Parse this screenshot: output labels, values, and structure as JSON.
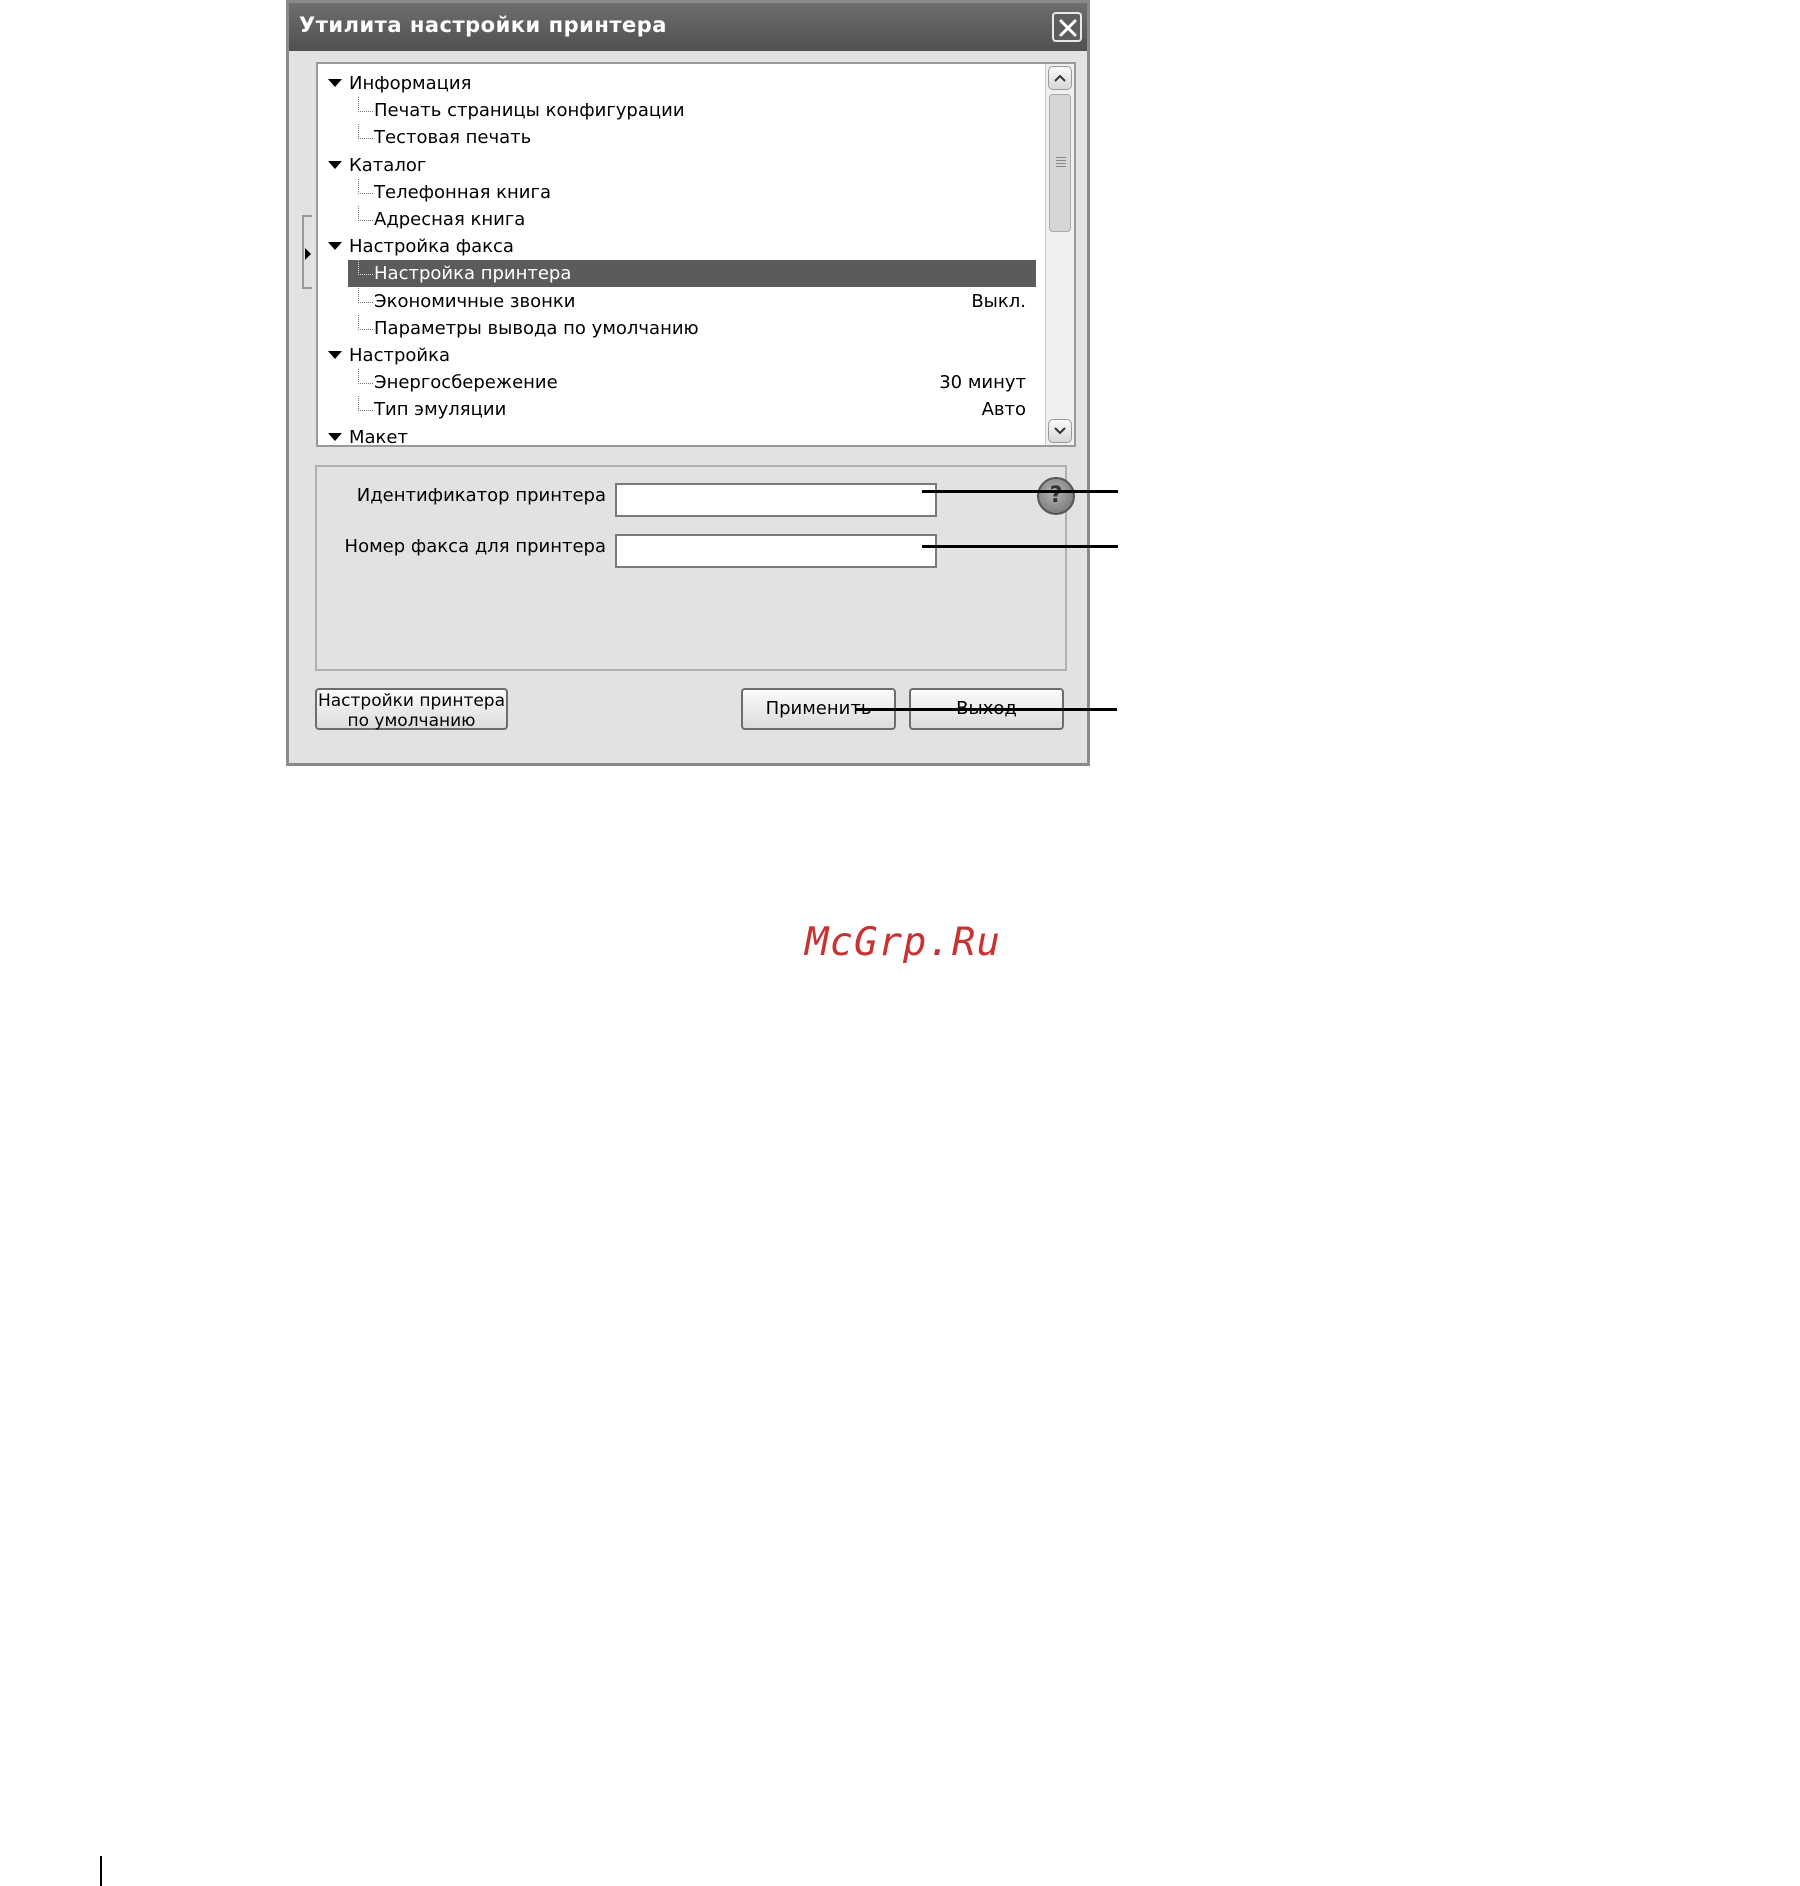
{
  "window": {
    "title": "Утилита настройки принтера"
  },
  "tree": {
    "rows": [
      {
        "type": "category",
        "label": "Информация"
      },
      {
        "type": "item",
        "label": "Печать страницы конфигурации",
        "value": ""
      },
      {
        "type": "item",
        "label": "Тестовая печать",
        "value": ""
      },
      {
        "type": "category",
        "label": "Каталог"
      },
      {
        "type": "item",
        "label": "Телефонная книга",
        "value": ""
      },
      {
        "type": "item",
        "label": "Адресная книга",
        "value": ""
      },
      {
        "type": "category",
        "label": "Настройка факса"
      },
      {
        "type": "item",
        "label": "Настройка принтера",
        "value": "",
        "selected": true
      },
      {
        "type": "item",
        "label": "Экономичные звонки",
        "value": "Выкл."
      },
      {
        "type": "item",
        "label": "Параметры вывода по умолчанию",
        "value": ""
      },
      {
        "type": "category",
        "label": "Настройка"
      },
      {
        "type": "item",
        "label": "Энергосбережение",
        "value": "30 минут"
      },
      {
        "type": "item",
        "label": "Тип эмуляции",
        "value": "Авто"
      },
      {
        "type": "category",
        "label": "Макет"
      }
    ]
  },
  "form": {
    "printer_id_label": "Идентификатор принтера",
    "printer_id_value": "",
    "fax_number_label": "Номер факса для принтера",
    "fax_number_value": "",
    "help_glyph": "?"
  },
  "buttons": {
    "defaults_line1": "Настройки принтера",
    "defaults_line2": "по умолчанию",
    "apply": "Применить",
    "exit": "Выход"
  },
  "watermark": "McGrp.Ru"
}
